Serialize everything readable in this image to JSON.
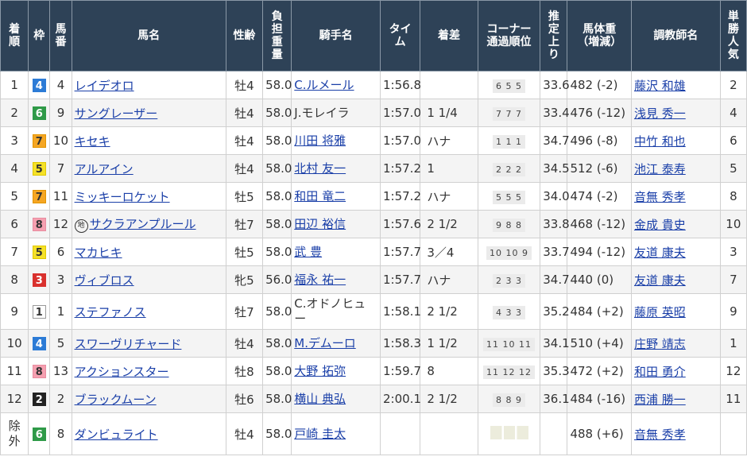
{
  "headers": {
    "rank": [
      "着",
      "順"
    ],
    "waku": [
      "枠"
    ],
    "umaban": [
      "馬",
      "番"
    ],
    "horse": [
      "馬名"
    ],
    "sexage": [
      "性齢"
    ],
    "weight": [
      "負",
      "担",
      "重",
      "量"
    ],
    "jockey": [
      "騎手名"
    ],
    "time": [
      "タイ",
      "ム"
    ],
    "margin": [
      "着差"
    ],
    "corner": [
      "コーナー",
      "通過順位"
    ],
    "last3f": [
      "推",
      "定",
      "上",
      "り"
    ],
    "body": [
      "馬体重",
      "（増減）"
    ],
    "trainer": [
      "調教師名"
    ],
    "pop": [
      "単",
      "勝",
      "人",
      "気"
    ]
  },
  "waku_colors": {
    "1": {
      "bg": "#ffffff",
      "fg": "#333333",
      "border": "#999999"
    },
    "2": {
      "bg": "#222222",
      "fg": "#ffffff",
      "border": "#222222"
    },
    "3": {
      "bg": "#d9312e",
      "fg": "#ffffff",
      "border": "#d9312e"
    },
    "4": {
      "bg": "#2c7bd6",
      "fg": "#ffffff",
      "border": "#2c7bd6"
    },
    "5": {
      "bg": "#f5e128",
      "fg": "#333333",
      "border": "#e0c800"
    },
    "6": {
      "bg": "#2f9a48",
      "fg": "#ffffff",
      "border": "#2f9a48"
    },
    "7": {
      "bg": "#f5a623",
      "fg": "#333333",
      "border": "#e29400"
    },
    "8": {
      "bg": "#f5a0b0",
      "fg": "#333333",
      "border": "#e88ca0"
    }
  },
  "rows": [
    {
      "rank": "1",
      "waku": "4",
      "umaban": "4",
      "horse": "レイデオロ",
      "local": false,
      "sexage": "牡4",
      "weight": "58.0",
      "jockey": "C.ルメール",
      "jockey_link": true,
      "time": "1:56.8",
      "margin": "",
      "corner": "6 5 5",
      "last3f": "33.6",
      "body": "482 (-2)",
      "trainer": "藤沢 和雄",
      "pop": "2"
    },
    {
      "rank": "2",
      "waku": "6",
      "umaban": "9",
      "horse": "サングレーザー",
      "local": false,
      "sexage": "牡4",
      "weight": "58.0",
      "jockey": "J.モレイラ",
      "jockey_link": false,
      "time": "1:57.0",
      "margin": "1 1/4",
      "corner": "7 7 7",
      "last3f": "33.4",
      "body": "476 (-12)",
      "trainer": "浅見 秀一",
      "pop": "4"
    },
    {
      "rank": "3",
      "waku": "7",
      "umaban": "10",
      "horse": "キセキ",
      "local": false,
      "sexage": "牡4",
      "weight": "58.0",
      "jockey": "川田 将雅",
      "jockey_link": true,
      "time": "1:57.0",
      "margin": "ハナ",
      "corner": "1 1 1",
      "last3f": "34.7",
      "body": "496 (-8)",
      "trainer": "中竹 和也",
      "pop": "6"
    },
    {
      "rank": "4",
      "waku": "5",
      "umaban": "7",
      "horse": "アルアイン",
      "local": false,
      "sexage": "牡4",
      "weight": "58.0",
      "jockey": "北村 友一",
      "jockey_link": true,
      "time": "1:57.2",
      "margin": "1",
      "corner": "2 2 2",
      "last3f": "34.5",
      "body": "512 (-6)",
      "trainer": "池江 泰寿",
      "pop": "5"
    },
    {
      "rank": "5",
      "waku": "7",
      "umaban": "11",
      "horse": "ミッキーロケット",
      "local": false,
      "sexage": "牡5",
      "weight": "58.0",
      "jockey": "和田 竜二",
      "jockey_link": true,
      "time": "1:57.2",
      "margin": "ハナ",
      "corner": "5 5 5",
      "last3f": "34.0",
      "body": "474 (-2)",
      "trainer": "音無 秀孝",
      "pop": "8"
    },
    {
      "rank": "6",
      "waku": "8",
      "umaban": "12",
      "horse": "サクラアンプルール",
      "local": true,
      "sexage": "牡7",
      "weight": "58.0",
      "jockey": "田辺 裕信",
      "jockey_link": true,
      "time": "1:57.6",
      "margin": "2 1/2",
      "corner": "9 8 8",
      "last3f": "33.8",
      "body": "468 (-12)",
      "trainer": "金成 貴史",
      "pop": "10"
    },
    {
      "rank": "7",
      "waku": "5",
      "umaban": "6",
      "horse": "マカヒキ",
      "local": false,
      "sexage": "牡5",
      "weight": "58.0",
      "jockey": "武 豊",
      "jockey_link": true,
      "time": "1:57.7",
      "margin": "3／4",
      "corner": "10 10 9",
      "last3f": "33.7",
      "body": "494 (-12)",
      "trainer": "友道 康夫",
      "pop": "3"
    },
    {
      "rank": "8",
      "waku": "3",
      "umaban": "3",
      "horse": "ヴィブロス",
      "local": false,
      "sexage": "牝5",
      "weight": "56.0",
      "jockey": "福永 祐一",
      "jockey_link": true,
      "time": "1:57.7",
      "margin": "ハナ",
      "corner": "2 3 3",
      "last3f": "34.7",
      "body": "440 (0)",
      "trainer": "友道 康夫",
      "pop": "7"
    },
    {
      "rank": "9",
      "waku": "1",
      "umaban": "1",
      "horse": "ステファノス",
      "local": false,
      "sexage": "牡7",
      "weight": "58.0",
      "jockey": "C.オドノヒュー",
      "jockey_link": false,
      "time": "1:58.1",
      "margin": "2 1/2",
      "corner": "4 3 3",
      "last3f": "35.2",
      "body": "484 (+2)",
      "trainer": "藤原 英昭",
      "pop": "9"
    },
    {
      "rank": "10",
      "waku": "4",
      "umaban": "5",
      "horse": "スワーヴリチャード",
      "local": false,
      "sexage": "牡4",
      "weight": "58.0",
      "jockey": "M.デムーロ",
      "jockey_link": true,
      "time": "1:58.3",
      "margin": "1 1/2",
      "corner": "11 10 11",
      "last3f": "34.1",
      "body": "510 (+4)",
      "trainer": "庄野 靖志",
      "pop": "1"
    },
    {
      "rank": "11",
      "waku": "8",
      "umaban": "13",
      "horse": "アクションスター",
      "local": false,
      "sexage": "牡8",
      "weight": "58.0",
      "jockey": "大野 拓弥",
      "jockey_link": true,
      "time": "1:59.7",
      "margin": "8",
      "corner": "11 12 12",
      "last3f": "35.3",
      "body": "472 (+2)",
      "trainer": "和田 勇介",
      "pop": "12"
    },
    {
      "rank": "12",
      "waku": "2",
      "umaban": "2",
      "horse": "ブラックムーン",
      "local": false,
      "sexage": "牡6",
      "weight": "58.0",
      "jockey": "横山 典弘",
      "jockey_link": true,
      "time": "2:00.1",
      "margin": "2 1/2",
      "corner": "8 8 9",
      "last3f": "36.1",
      "body": "484 (-16)",
      "trainer": "西浦 勝一",
      "pop": "11"
    },
    {
      "rank": "除外",
      "waku": "6",
      "umaban": "8",
      "horse": "ダンビュライト",
      "local": false,
      "sexage": "牡4",
      "weight": "58.0",
      "jockey": "戸崎 圭太",
      "jockey_link": true,
      "time": "",
      "margin": "",
      "corner": "",
      "last3f": "",
      "body": "488 (+6)",
      "trainer": "音無 秀孝",
      "pop": ""
    }
  ],
  "local_mark": "地"
}
